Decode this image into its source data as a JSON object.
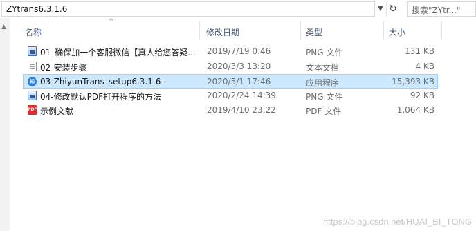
{
  "address_bar": {
    "path": "ZYtrans6.3.1.6",
    "search_placeholder": "搜索\"ZYtr...\""
  },
  "columns": {
    "name": "名称",
    "date": "修改日期",
    "type": "类型",
    "size": "大小"
  },
  "files": [
    {
      "name": "01_确保加一个客服微信【真人给您答疑...",
      "date": "2019/7/19 0:46",
      "type": "PNG 文件",
      "size": "131 KB",
      "icon": "png-image-icon",
      "selected": false
    },
    {
      "name": "02-安装步骤",
      "date": "2020/3/3 13:20",
      "type": "文本文档",
      "size": "4 KB",
      "icon": "text-document-icon",
      "selected": false
    },
    {
      "name": "03-ZhiyunTrans_setup6.3.1.6-",
      "date": "2020/5/1 17:46",
      "type": "应用程序",
      "size": "15,393 KB",
      "icon": "application-icon",
      "selected": true
    },
    {
      "name": "04-修改默认PDF打开程序的方法",
      "date": "2020/2/24 14:39",
      "type": "PNG 文件",
      "size": "92 KB",
      "icon": "png-image-icon",
      "selected": false
    },
    {
      "name": "示例文献",
      "date": "2019/4/10 23:22",
      "type": "PDF 文件",
      "size": "1,064 KB",
      "icon": "pdf-file-icon",
      "selected": false
    }
  ],
  "watermark": "https://blog.csdn.net/HUAI_BI_TONG",
  "colors": {
    "selection_bg": "#cce8ff",
    "selection_border": "#99d1ff",
    "header_text": "#4c607a"
  }
}
